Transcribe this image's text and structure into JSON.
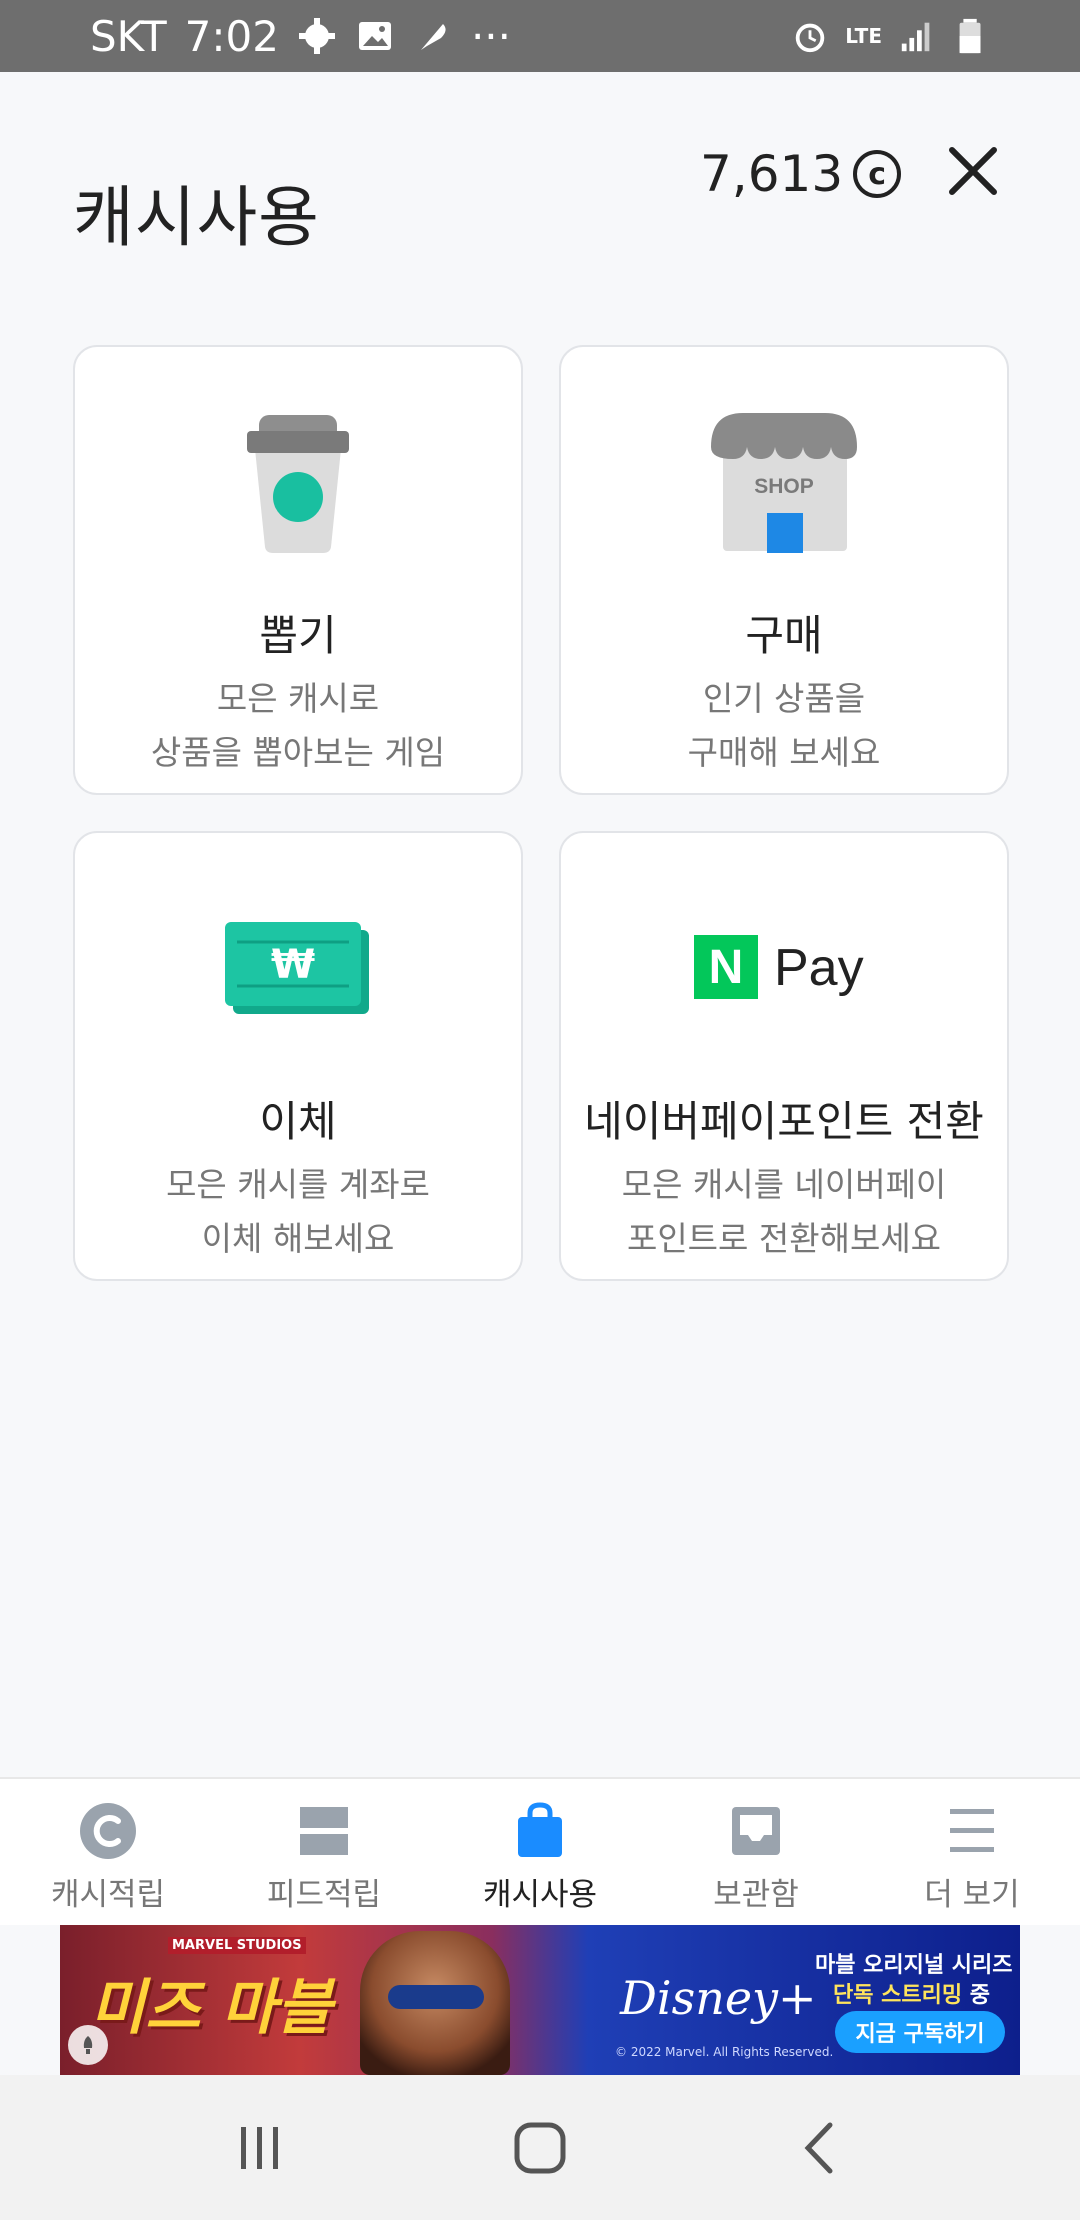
{
  "status_bar": {
    "carrier": "SKT",
    "time": "7:02",
    "more": "···",
    "network": "LTE"
  },
  "header": {
    "title": "캐시사용",
    "balance": "7,613",
    "coin_symbol": "c"
  },
  "cards": [
    {
      "title": "뽑기",
      "desc_line1": "모은 캐시로",
      "desc_line2": "상품을 뽑아보는 게임",
      "icon": "coffee-cup-icon"
    },
    {
      "title": "구매",
      "desc_line1": "인기 상품을",
      "desc_line2": "구매해 보세요",
      "icon": "shop-icon",
      "icon_text": "SHOP"
    },
    {
      "title": "이체",
      "desc_line1": "모은 캐시를 계좌로",
      "desc_line2": "이체 해보세요",
      "icon": "won-bill-icon",
      "icon_text": "₩"
    },
    {
      "title": "네이버페이포인트 전환",
      "desc_line1": "모은 캐시를 네이버페이",
      "desc_line2": "포인트로 전환해보세요",
      "icon": "naver-pay-icon",
      "icon_text": "N",
      "icon_text2": "Pay"
    }
  ],
  "tabs": [
    {
      "label": "캐시적립",
      "icon": "cash-coin-icon",
      "active": false
    },
    {
      "label": "피드적립",
      "icon": "feed-icon",
      "active": false
    },
    {
      "label": "캐시사용",
      "icon": "shopping-bag-icon",
      "active": true
    },
    {
      "label": "보관함",
      "icon": "inbox-icon",
      "active": false
    },
    {
      "label": "더 보기",
      "icon": "menu-icon",
      "active": false
    }
  ],
  "ad": {
    "brand_small": "MARVEL STUDIOS",
    "logo_text": "미즈 마블",
    "service": "Disney+",
    "copyright": "© 2022 Marvel. All Rights Reserved.",
    "line1": "마블 오리지널 시리즈",
    "line2_highlight": "단독 스트리밍",
    "line2_rest": " 중",
    "cta": "지금 구독하기"
  },
  "colors": {
    "accent_blue": "#1a8cff",
    "teal": "#19bfa0",
    "naver_green": "#03c75a",
    "shop_blue": "#1e88e5"
  }
}
